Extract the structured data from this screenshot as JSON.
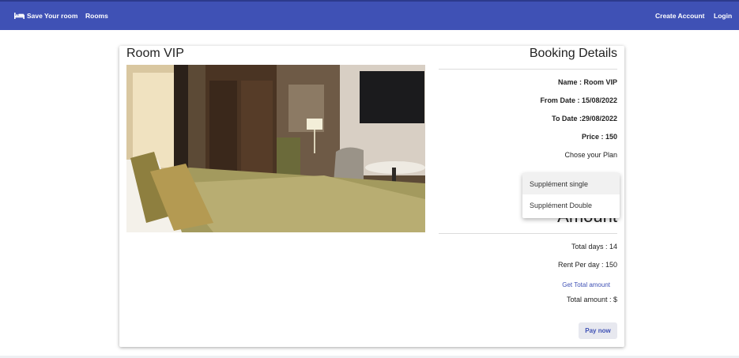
{
  "nav": {
    "brand": "Save Your room",
    "rooms": "Rooms",
    "create_account": "Create Account",
    "login": "Login",
    "bar_color": "#3f51b5",
    "brand_icon": "bed-icon"
  },
  "room": {
    "title": "Room VIP"
  },
  "booking": {
    "title": "Booking Details",
    "name": "Name : Room VIP",
    "from_date": "From Date : 15/08/2022",
    "to_date": "To Date :29/08/2022",
    "price": "Price : 150",
    "plan_label": "Chose your Plan",
    "plan_options": [
      "Supplément single",
      "Supplément Double"
    ],
    "amount_heading": "Amount",
    "total_days": "Total days : 14",
    "rent_per_day": "Rent Per day : 150",
    "get_total_link": "Get Total amount",
    "total_amount": "Total amount : $",
    "pay_button": "Pay now",
    "accent_color": "#3f51b5"
  }
}
